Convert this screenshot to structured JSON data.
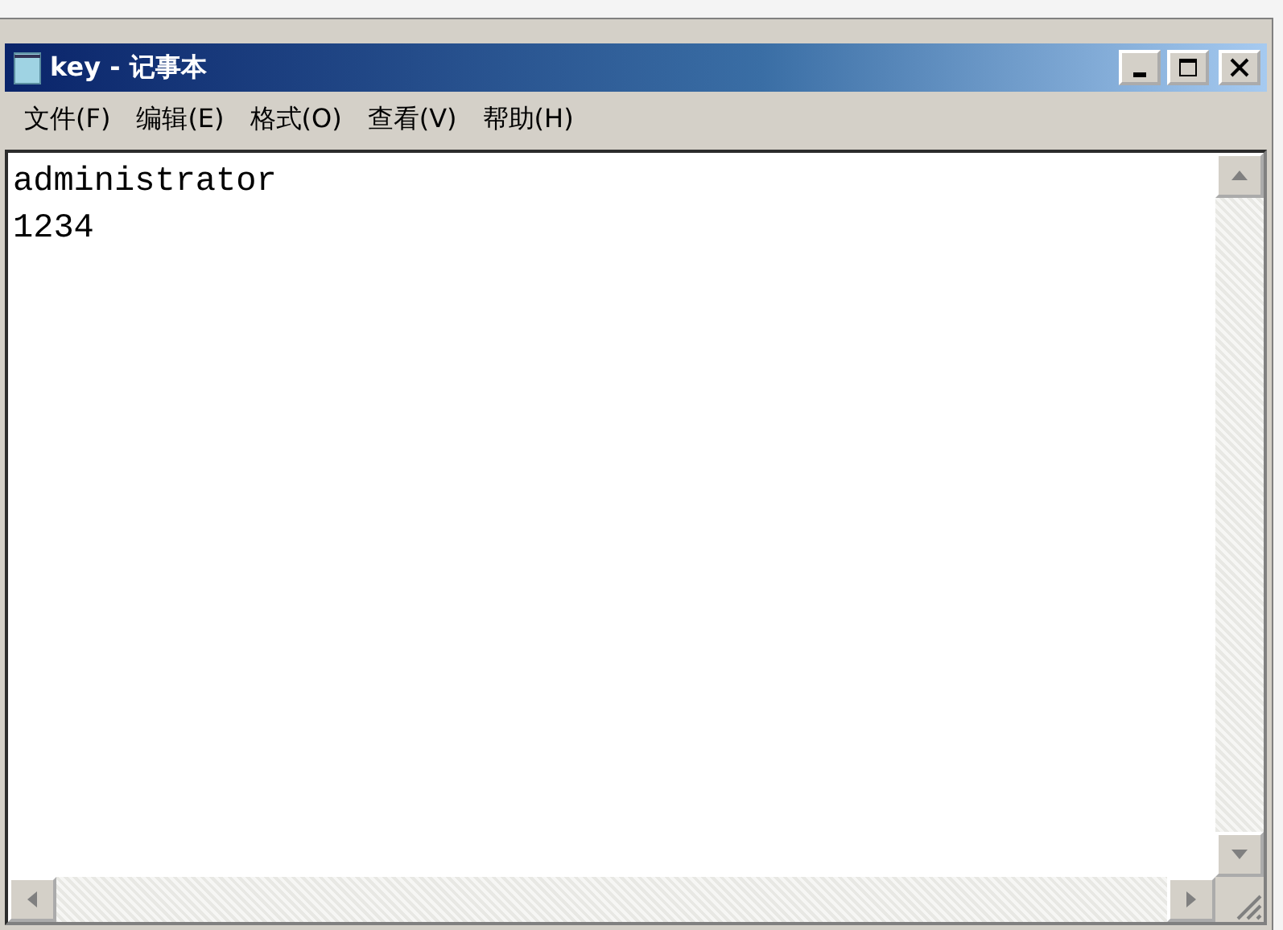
{
  "window": {
    "title": "key - 记事本"
  },
  "menu": [
    "文件(F)",
    "编辑(E)",
    "格式(O)",
    "查看(V)",
    "帮助(H)"
  ],
  "document": {
    "lines": [
      "administrator",
      "1234"
    ]
  }
}
